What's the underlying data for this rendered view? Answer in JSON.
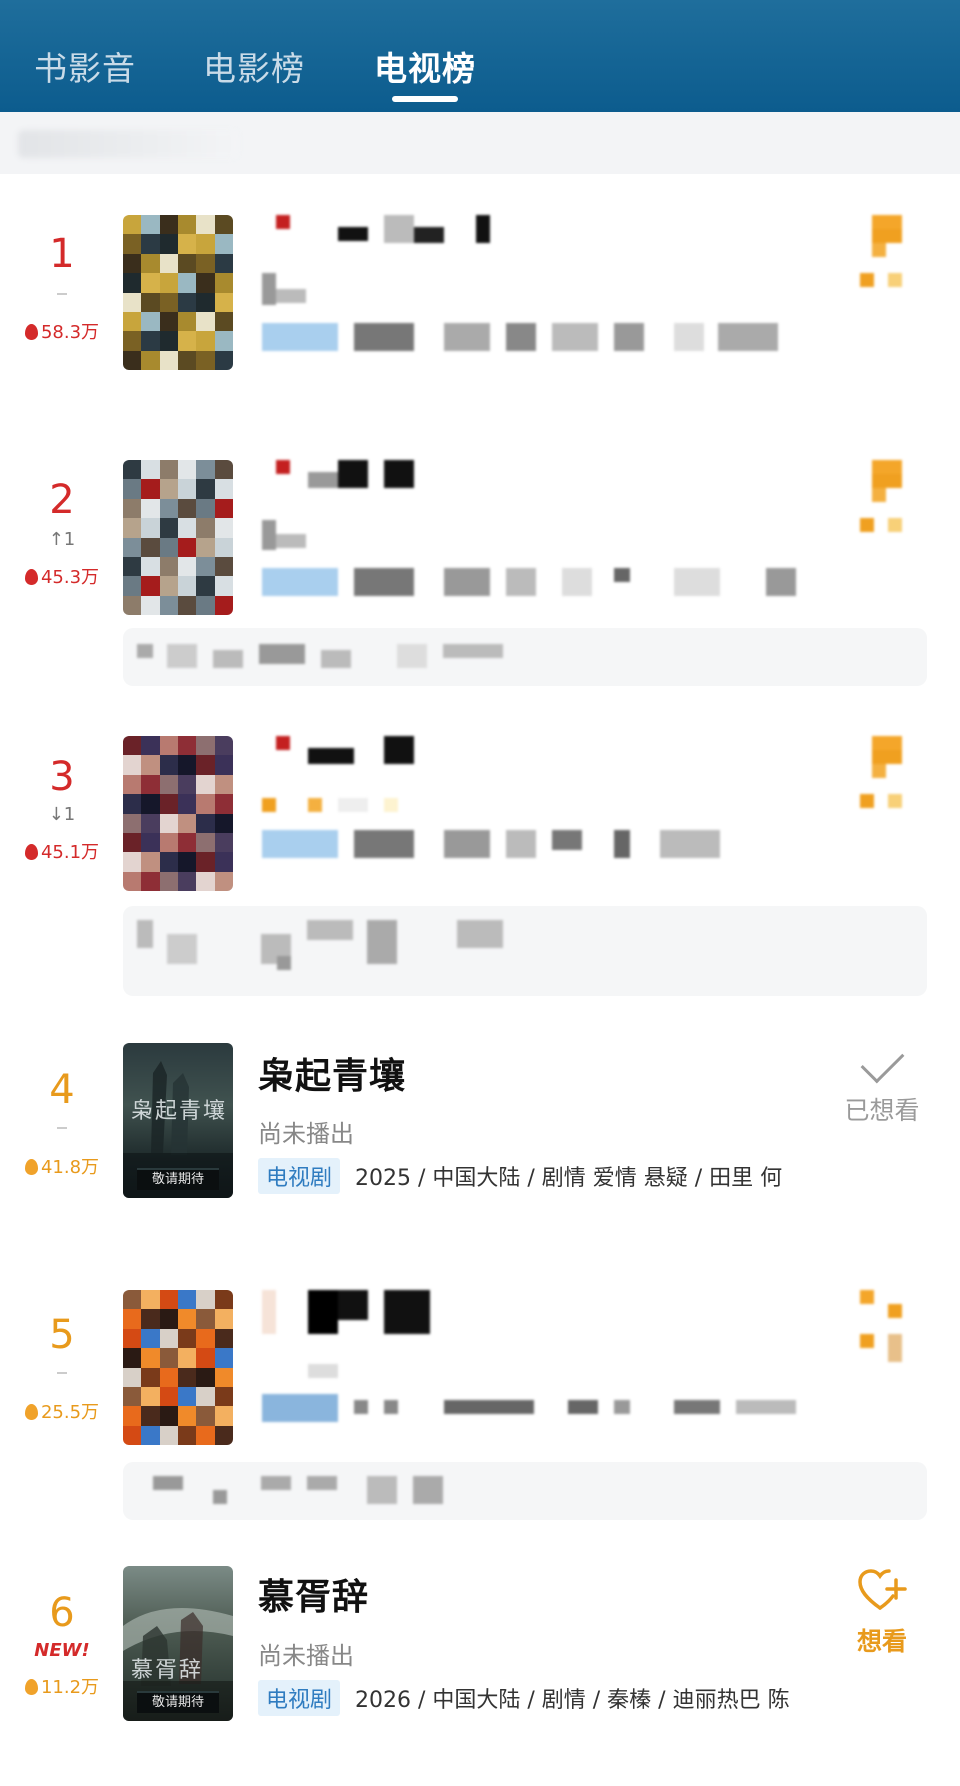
{
  "tabs": [
    {
      "label": "书影音",
      "active": false
    },
    {
      "label": "电影榜",
      "active": false
    },
    {
      "label": "电视榜",
      "active": true
    }
  ],
  "colors": {
    "header": "#0c5c8e",
    "rank_top": "#d42a2a",
    "rank_rest": "#e89a1c",
    "tag_bg": "#e4f1fb",
    "tag_text": "#2f7cc0"
  },
  "items": [
    {
      "rank": "1",
      "change": "",
      "heat": "58.3万"
    },
    {
      "rank": "2",
      "change": "↑1",
      "heat": "45.3万"
    },
    {
      "rank": "3",
      "change": "↓1",
      "heat": "45.1万"
    },
    {
      "rank": "4",
      "change": "",
      "heat": "41.8万",
      "title": "枭起青壤",
      "status": "尚未播出",
      "tag": "电视剧",
      "meta": "2025 / 中国大陆 / 剧情 爱情 悬疑 / 田里 何",
      "action": "已想看",
      "action_icon": "check-icon",
      "poster_text": "枭起青壤",
      "poster_badge": "敬请期待"
    },
    {
      "rank": "5",
      "change": "",
      "heat": "25.5万"
    },
    {
      "rank": "6",
      "change": "",
      "badge": "NEW!",
      "heat": "11.2万",
      "title": "慕胥辞",
      "status": "尚未播出",
      "tag": "电视剧",
      "meta": "2026 / 中国大陆 / 剧情 / 秦榛 / 迪丽热巴 陈",
      "action": "想看",
      "action_icon": "heart-plus-icon",
      "poster_text": "慕胥辞",
      "poster_badge": "敬请期待"
    }
  ]
}
